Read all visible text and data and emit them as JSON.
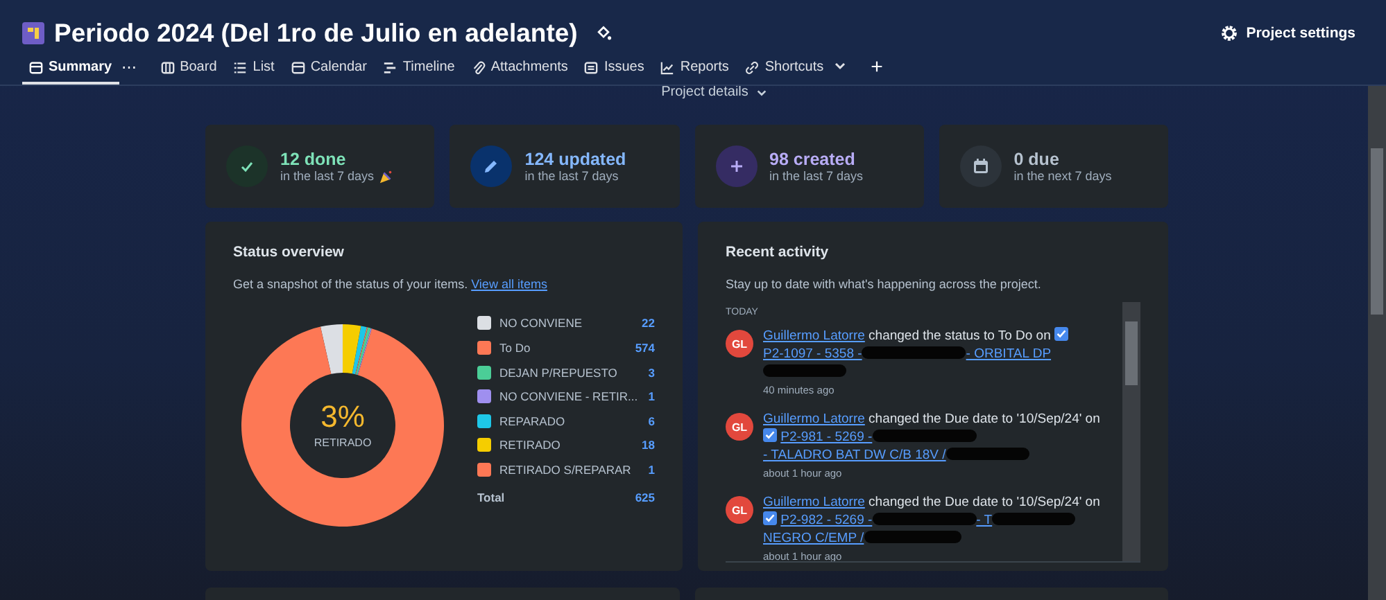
{
  "header": {
    "title": "Periodo 2024 (Del 1ro de Julio en adelante)",
    "settings": "Project settings"
  },
  "tabs": [
    {
      "label": "Summary",
      "selected": true
    },
    {
      "label": "Board",
      "selected": false
    },
    {
      "label": "List",
      "selected": false
    },
    {
      "label": "Calendar",
      "selected": false
    },
    {
      "label": "Timeline",
      "selected": false
    },
    {
      "label": "Attachments",
      "selected": false
    },
    {
      "label": "Issues",
      "selected": false
    },
    {
      "label": "Reports",
      "selected": false
    },
    {
      "label": "Shortcuts",
      "selected": false
    }
  ],
  "tab_more": "⋯",
  "add_tab": "+",
  "project_details": "Project details",
  "stats": [
    {
      "kind": "done",
      "value": "12 done",
      "sub": "in the last 7 days",
      "color": "#7ee2b8"
    },
    {
      "kind": "updated",
      "value": "124 updated",
      "sub": "in the last 7 days",
      "color": "#85b8ff"
    },
    {
      "kind": "created",
      "value": "98 created",
      "sub": "in the last 7 days",
      "color": "#b8acf6"
    },
    {
      "kind": "due",
      "value": "0 due",
      "sub": "in the next 7 days",
      "color": "#b6c2cf"
    }
  ],
  "status_overview": {
    "title": "Status overview",
    "description": "Get a snapshot of the status of your items.",
    "link": "View all items",
    "center_value": "3%",
    "center_label": "RETIRADO",
    "slices": [
      {
        "color": "#dcdfe4"
      },
      {
        "color": "#fd7855"
      },
      {
        "color": "#4bce97"
      },
      {
        "color": "#9f8fef"
      },
      {
        "color": "#1ec7e8"
      },
      {
        "color": "#f5cd00"
      },
      {
        "color": "#fd7855"
      }
    ],
    "total_label": "Total",
    "total": "625",
    "chart_data": {
      "type": "donut",
      "categories": [
        "NO CONVIENE",
        "To Do",
        "DEJAN P/REPUESTO",
        "NO CONVIENE - RETIR...",
        "REPARADO",
        "RETIRADO",
        "RETIRADO S/REPARAR"
      ],
      "values": [
        22,
        574,
        3,
        1,
        6,
        18,
        1
      ],
      "value_labels": [
        "22",
        "574",
        "3",
        "1",
        "6",
        "18",
        "1"
      ],
      "legend": "right"
    }
  },
  "recent_activity": {
    "title": "Recent activity",
    "description": "Stay up to date with what's happening across the project.",
    "group": "TODAY",
    "items": [
      {
        "initials": "GL",
        "user": "Guillermo Latorre",
        "action": "changed the status to To Do on",
        "link": [
          {
            "kind": "text",
            "text": "P2-1097 - 5358 -"
          },
          {
            "kind": "redacted"
          },
          {
            "kind": "text",
            "text": "- ORBITAL DP"
          },
          {
            "kind": "redacted"
          }
        ],
        "time": "40 minutes ago"
      },
      {
        "initials": "GL",
        "user": "Guillermo Latorre",
        "action": "changed the Due date to '10/Sep/24' on",
        "link": [
          {
            "kind": "text",
            "text": "P2-981 - 5269 -"
          },
          {
            "kind": "redacted"
          },
          {
            "kind": "text",
            "text": "- TALADRO BAT DW C/B 18V /"
          },
          {
            "kind": "redacted"
          }
        ],
        "time": "about 1 hour ago"
      },
      {
        "initials": "GL",
        "user": "Guillermo Latorre",
        "action": "changed the Due date to '10/Sep/24' on",
        "link": [
          {
            "kind": "text",
            "text": "P2-982 - 5269 -"
          },
          {
            "kind": "redacted"
          },
          {
            "kind": "text",
            "text": "- T"
          },
          {
            "kind": "redacted"
          },
          {
            "kind": "text",
            "text": "NEGRO C/EMP /"
          },
          {
            "kind": "redacted"
          }
        ],
        "time": "about 1 hour ago"
      }
    ]
  }
}
